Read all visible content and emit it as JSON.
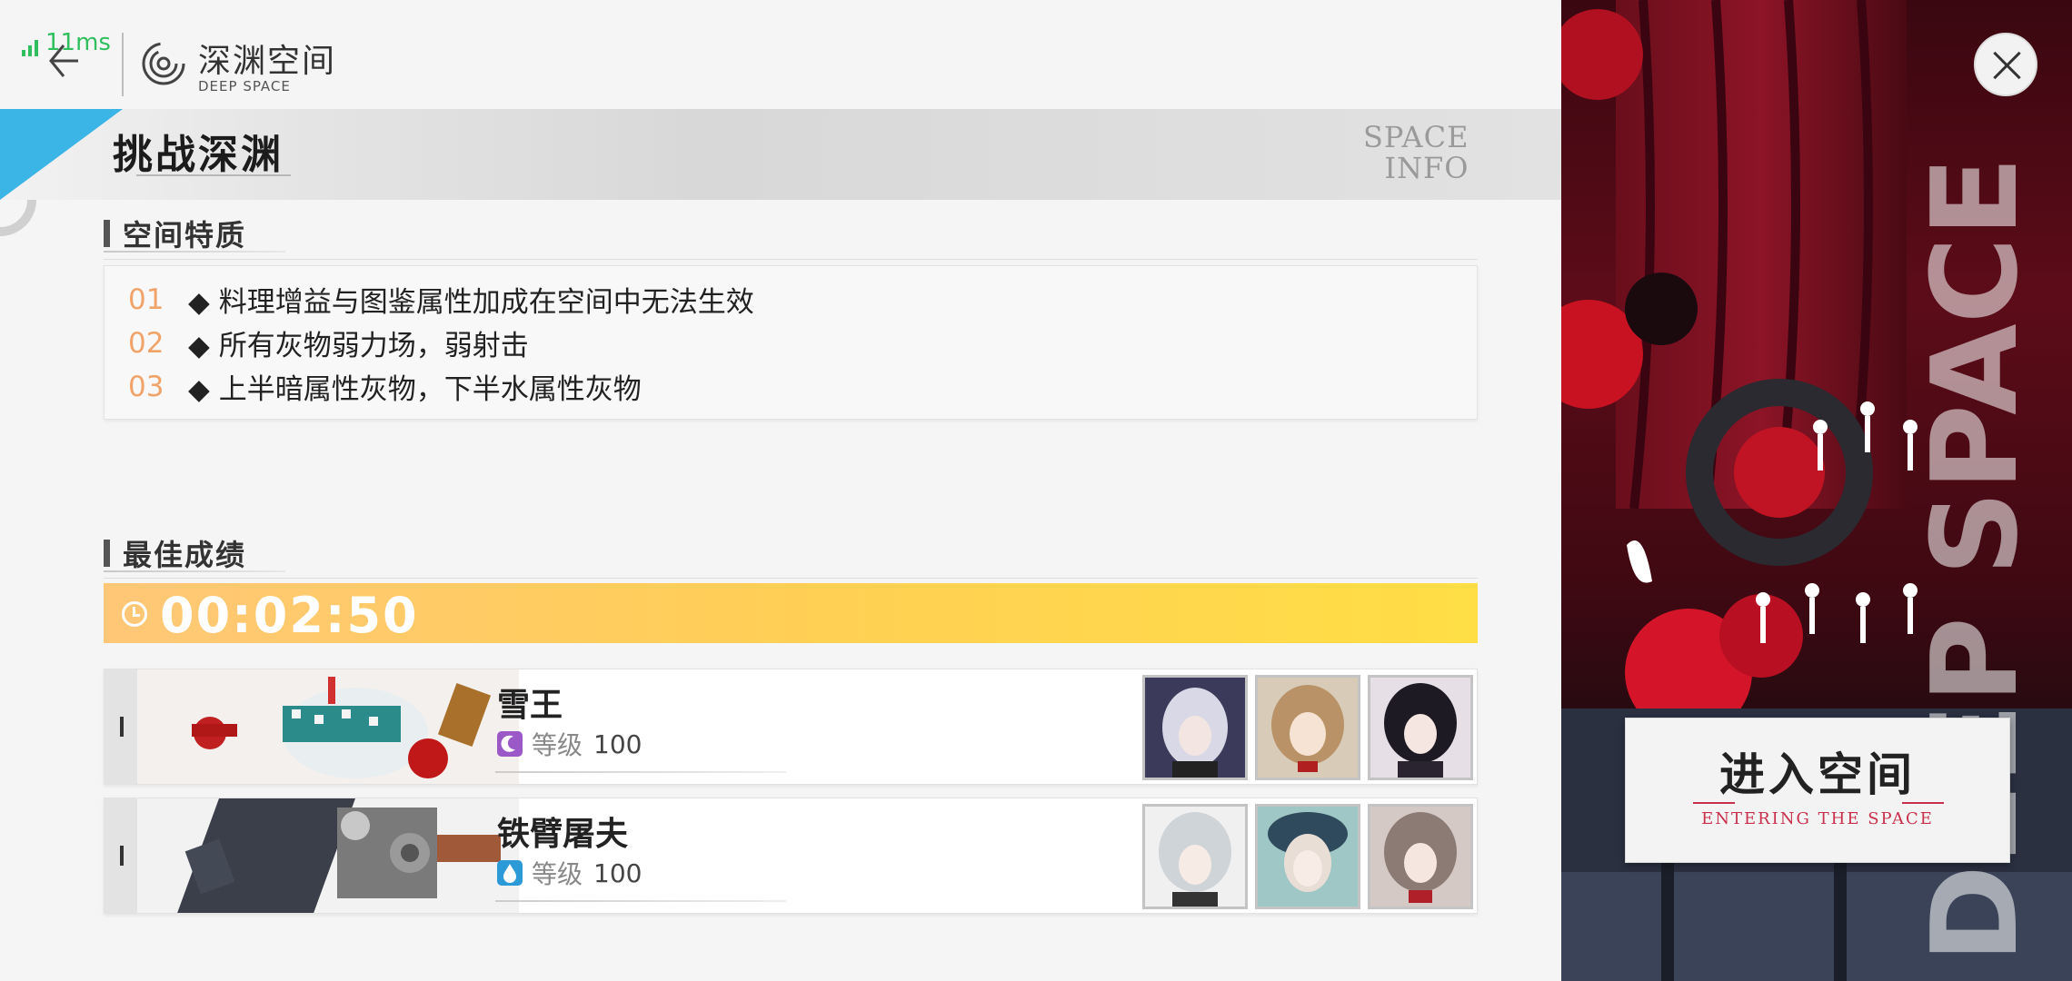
{
  "status": {
    "ping": "11ms"
  },
  "header": {
    "title": "深渊空间",
    "subtitle": "DEEP SPACE"
  },
  "banner": {
    "title": "挑战深渊",
    "side_line1": "SPACE",
    "side_line2": "INFO"
  },
  "traits": {
    "heading": "空间特质",
    "items": [
      {
        "num": "01",
        "text": "◆ 料理增益与图鉴属性加成在空间中无法生效"
      },
      {
        "num": "02",
        "text": "◆ 所有灰物弱力场，弱射击"
      },
      {
        "num": "03",
        "text": "◆ 上半暗属性灰物，下半水属性灰物"
      }
    ]
  },
  "best": {
    "heading": "最佳成绩",
    "time": "00:02:50",
    "teams": [
      {
        "name": "雪王",
        "level_label": "等级",
        "level": "100",
        "element": "dark",
        "element_color": "#9b59c8"
      },
      {
        "name": "铁臂屠夫",
        "level_label": "等级",
        "level": "100",
        "element": "water",
        "element_color": "#2d9ad8"
      }
    ]
  },
  "enter_button": {
    "label": "进入空间",
    "sub": "ENTERING THE SPACE"
  },
  "side_text": "DEEP SPACE",
  "colors": {
    "accent_blue": "#3bb4e6",
    "number_orange": "#f0a46a",
    "timer_yellow": "#ffd44a",
    "enter_red": "#c8304c"
  },
  "icons": [
    "back-arrow-icon",
    "deep-space-logo-icon",
    "clock-icon",
    "moon-icon",
    "water-drop-icon",
    "close-icon"
  ]
}
